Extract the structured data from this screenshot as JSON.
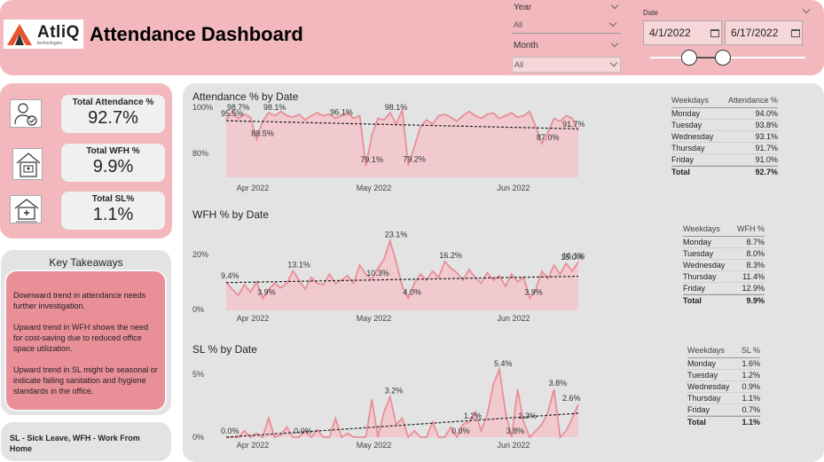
{
  "header": {
    "logo_text": "AtliQ",
    "logo_sub": "technologies",
    "title": "Attendance Dashboard",
    "year_label": "Year",
    "year_value": "All",
    "month_label": "Month",
    "month_value": "All",
    "date_label": "Date",
    "date_start": "4/1/2022",
    "date_end": "6/17/2022",
    "date_range_fraction": [
      0.25,
      0.47
    ]
  },
  "kpis": [
    {
      "label": "Total Attendance %",
      "value": "92.7%",
      "icon": "person-check-icon"
    },
    {
      "label": "Total WFH %",
      "value": "9.9%",
      "icon": "home-office-icon"
    },
    {
      "label": "Total SL%",
      "value": "1.1%",
      "icon": "sick-leave-icon"
    }
  ],
  "takeaways": {
    "title": "Key Takeaways",
    "points": [
      "Downward trend in attendance needs further investigation.",
      "Upward trend in WFH shows the need for cost-saving due to reduced office space utilization.",
      "Upward trend in SL might be seasonal or indicate falling sanitation and hygiene standards in the office."
    ]
  },
  "legend_note": "SL - Sick Leave, WFH - Work From Home",
  "colors": {
    "accent": "#f2b8bd",
    "line": "#e98f98",
    "area": "#f2c6ca",
    "panel": "#e3e3e3"
  },
  "tables": [
    {
      "headers": [
        "Weekdays",
        "Attendance %"
      ],
      "rows": [
        [
          "Monday",
          "94.0%"
        ],
        [
          "Tuesday",
          "93.8%"
        ],
        [
          "Wednesday",
          "93.1%"
        ],
        [
          "Thursday",
          "91.7%"
        ],
        [
          "Friday",
          "91.0%"
        ]
      ],
      "total": [
        "Total",
        "92.7%"
      ]
    },
    {
      "headers": [
        "Weekdays",
        "WFH %"
      ],
      "rows": [
        [
          "Monday",
          "8.7%"
        ],
        [
          "Tuesday",
          "8.0%"
        ],
        [
          "Wednesday",
          "8.3%"
        ],
        [
          "Thursday",
          "11.4%"
        ],
        [
          "Friday",
          "12.9%"
        ]
      ],
      "total": [
        "Total",
        "9.9%"
      ]
    },
    {
      "headers": [
        "Weekdays",
        "SL %"
      ],
      "rows": [
        [
          "Monday",
          "1.6%"
        ],
        [
          "Tuesday",
          "1.2%"
        ],
        [
          "Wednesday",
          "0.9%"
        ],
        [
          "Thursday",
          "1.1%"
        ],
        [
          "Friday",
          "0.7%"
        ]
      ],
      "total": [
        "Total",
        "1.1%"
      ]
    }
  ],
  "chart_data": [
    {
      "type": "area",
      "title": "Attendance % by Date",
      "x_ticks": [
        "Apr 2022",
        "May 2022",
        "Jun 2022"
      ],
      "y_ticks": [
        "100%",
        "80%"
      ],
      "ylim": [
        75,
        100
      ],
      "trendline": [
        95.2,
        92.3
      ],
      "values": [
        95.5,
        98.7,
        96.0,
        97.5,
        96.5,
        88.5,
        95.0,
        98.1,
        97.0,
        98.5,
        97.0,
        96.5,
        97.5,
        95.5,
        97.0,
        98.0,
        97.0,
        97.5,
        96.1,
        97.0,
        98.0,
        96.0,
        97.0,
        79.1,
        90.0,
        96.0,
        95.5,
        98.1,
        94.0,
        99.0,
        79.2,
        86.0,
        93.0,
        95.5,
        94.0,
        97.0,
        97.5,
        96.5,
        95.0,
        97.0,
        98.5,
        97.0,
        96.0,
        97.5,
        98.0,
        96.0,
        97.0,
        98.0,
        96.5,
        97.0,
        98.5,
        93.0,
        87.0,
        91.0,
        96.0,
        95.0,
        97.0,
        96.0,
        91.7
      ],
      "labels": [
        {
          "i": 0,
          "text": "95.5%"
        },
        {
          "i": 1,
          "text": "98.7%"
        },
        {
          "i": 5,
          "text": "88.5%"
        },
        {
          "i": 7,
          "text": "98.1%"
        },
        {
          "i": 18,
          "text": "96.1%"
        },
        {
          "i": 23,
          "text": "79.1%"
        },
        {
          "i": 27,
          "text": "98.1%"
        },
        {
          "i": 30,
          "text": "79.2%"
        },
        {
          "i": 52,
          "text": "87.0%"
        },
        {
          "i": 58,
          "text": "91.7%"
        }
      ]
    },
    {
      "type": "area",
      "title": "WFH % by Date",
      "x_ticks": [
        "Apr 2022",
        "May 2022",
        "Jun 2022"
      ],
      "y_ticks": [
        "20%",
        "0%"
      ],
      "ylim": [
        0,
        25
      ],
      "trendline": [
        9.2,
        11.3
      ],
      "values": [
        9.4,
        7.0,
        5.0,
        8.5,
        6.0,
        9.5,
        3.9,
        7.0,
        9.0,
        7.5,
        9.0,
        13.1,
        10.0,
        7.0,
        11.0,
        9.0,
        8.5,
        12.0,
        9.0,
        10.0,
        11.5,
        9.0,
        15.0,
        12.0,
        10.3,
        14.0,
        17.0,
        23.1,
        16.0,
        8.0,
        4.0,
        9.0,
        12.0,
        10.0,
        13.0,
        11.0,
        16.2,
        14.0,
        12.5,
        10.0,
        13.5,
        11.0,
        9.0,
        12.5,
        10.0,
        11.5,
        8.0,
        12.0,
        9.5,
        11.0,
        3.9,
        7.0,
        13.0,
        10.5,
        15.0,
        12.0,
        15.6,
        13.0,
        16.1
      ],
      "labels": [
        {
          "i": 0,
          "text": "9.4%"
        },
        {
          "i": 6,
          "text": "3.9%"
        },
        {
          "i": 11,
          "text": "13.1%"
        },
        {
          "i": 24,
          "text": "10.3%"
        },
        {
          "i": 27,
          "text": "23.1%"
        },
        {
          "i": 30,
          "text": "4.0%"
        },
        {
          "i": 36,
          "text": "16.2%"
        },
        {
          "i": 50,
          "text": "3.9%"
        },
        {
          "i": 56,
          "text": "15.0%"
        },
        {
          "i": 58,
          "text": "16.1%"
        }
      ]
    },
    {
      "type": "area",
      "title": "SL % by Date",
      "x_ticks": [
        "Apr 2022",
        "May 2022",
        "Jun 2022"
      ],
      "y_ticks": [
        "5%",
        "0%"
      ],
      "ylim": [
        0,
        5.5
      ],
      "trendline": [
        0.0,
        1.9
      ],
      "values": [
        0.0,
        0.0,
        0.0,
        0.5,
        0.0,
        0.3,
        0.0,
        1.5,
        0.0,
        0.2,
        0.8,
        0.0,
        0.0,
        0.5,
        0.0,
        0.6,
        0.0,
        0.0,
        1.5,
        0.0,
        0.3,
        0.0,
        0.0,
        0.0,
        3.0,
        0.0,
        2.0,
        3.2,
        1.0,
        1.5,
        0.0,
        0.5,
        0.0,
        0.0,
        1.2,
        0.0,
        0.0,
        0.8,
        0.0,
        1.0,
        1.2,
        2.0,
        0.5,
        1.8,
        4.2,
        5.4,
        2.0,
        0.0,
        3.8,
        1.2,
        0.0,
        0.5,
        1.0,
        2.0,
        3.8,
        0.0,
        0.5,
        1.5,
        2.6
      ],
      "labels": [
        {
          "i": 0,
          "text": "0.0%"
        },
        {
          "i": 27,
          "text": "3.2%"
        },
        {
          "i": 12,
          "text": "0.0%"
        },
        {
          "i": 38,
          "text": "0.0%"
        },
        {
          "i": 40,
          "text": "1.2%"
        },
        {
          "i": 45,
          "text": "5.4%"
        },
        {
          "i": 47,
          "text": "3.8%"
        },
        {
          "i": 49,
          "text": "1.2%"
        },
        {
          "i": 54,
          "text": "3.8%"
        },
        {
          "i": 58,
          "text": "2.6%"
        }
      ]
    }
  ]
}
